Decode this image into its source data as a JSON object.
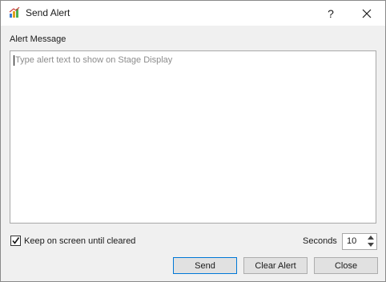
{
  "window": {
    "title": "Send Alert",
    "help": "?"
  },
  "message": {
    "label": "Alert Message",
    "value": "",
    "placeholder": "Type alert text to show on Stage Display"
  },
  "keep_on_screen": {
    "label": "Keep on screen until cleared",
    "checked": true
  },
  "seconds": {
    "label": "Seconds",
    "value": "10"
  },
  "buttons": {
    "send": "Send",
    "clear": "Clear Alert",
    "close": "Close"
  },
  "colors": {
    "default_button_border": "#0078d7",
    "placeholder": "#8c8c8c"
  }
}
